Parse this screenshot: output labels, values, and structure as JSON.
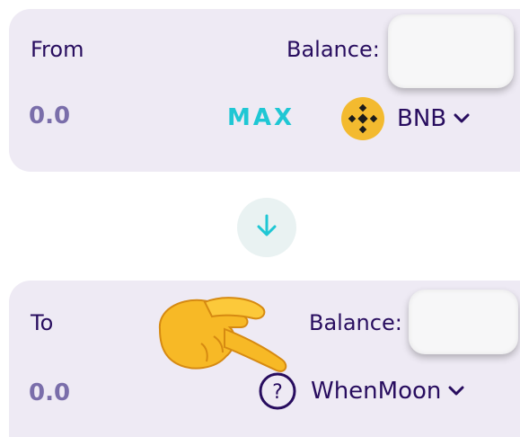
{
  "from": {
    "label": "From",
    "balance_label": "Balance:",
    "amount": "0.0",
    "max_label": "MAX",
    "token": {
      "symbol": "BNB",
      "icon": "bnb-logo-icon",
      "color": "#f3ba2f"
    }
  },
  "to": {
    "label": "To",
    "balance_label": "Balance:",
    "amount": "0.0",
    "token": {
      "symbol": "WhenMoon",
      "icon": "unknown-token-question-icon"
    }
  },
  "colors": {
    "panel_bg": "#eeeaf4",
    "text": "#280d5f",
    "muted": "#7a6eaa",
    "accent": "#1fc7d4"
  },
  "icons": {
    "switch": "arrow-down-icon",
    "pointer": "pointing-hand-emoji"
  }
}
